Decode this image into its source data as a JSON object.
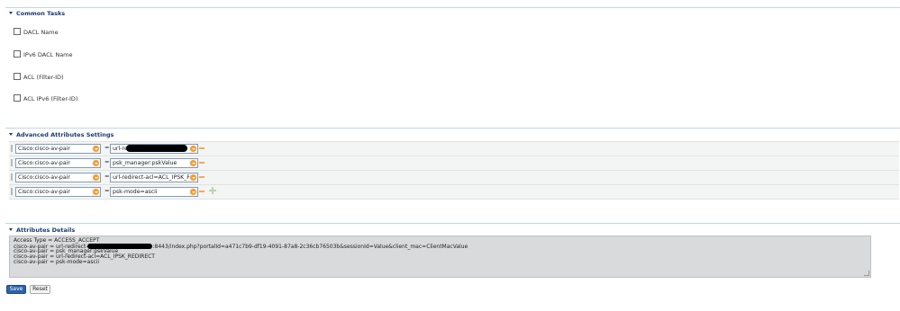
{
  "common_tasks": {
    "title": "Common Tasks",
    "items": [
      "DACL Name",
      "IPv6 DACL Name",
      "ACL  (Filter-ID)",
      "ACL IPv6 (Filter-ID)"
    ]
  },
  "advanced": {
    "title": "Advanced Attributes Settings",
    "eq": "=",
    "rows": [
      {
        "attribute": "Cisco:cisco-av-pair",
        "value": "url-redirect-"
      },
      {
        "attribute": "Cisco:cisco-av-pair",
        "value": "psk_manager:pskValue"
      },
      {
        "attribute": "Cisco:cisco-av-pair",
        "value": "url-redirect-acl=ACL_IPSK_R..."
      },
      {
        "attribute": "Cisco:cisco-av-pair",
        "value": "psk-mode=ascii"
      }
    ]
  },
  "details": {
    "title": "Attributes Details",
    "lines": [
      "Access Type = ACCESS_ACCEPT",
      "cisco-av-pair = url-redirect-",
      "cisco-av-pair = psk_manager:pskValue",
      "cisco-av-pair = url-redirect-acl=ACL_IPSK_REDIRECT",
      "cisco-av-pair = psk-mode=ascii"
    ],
    "line2_suffix": ":8443/index.php?portalId=a471c7b9-df19-4091-87a8-2c36cb76503b&sessionId=Value&client_mac=ClientMacValue"
  },
  "buttons": {
    "save": "Save",
    "reset": "Reset"
  },
  "colors": {
    "accent": "#1d3b6d",
    "dropdown": "#f59c2a",
    "save_button": "#2d61a9"
  }
}
